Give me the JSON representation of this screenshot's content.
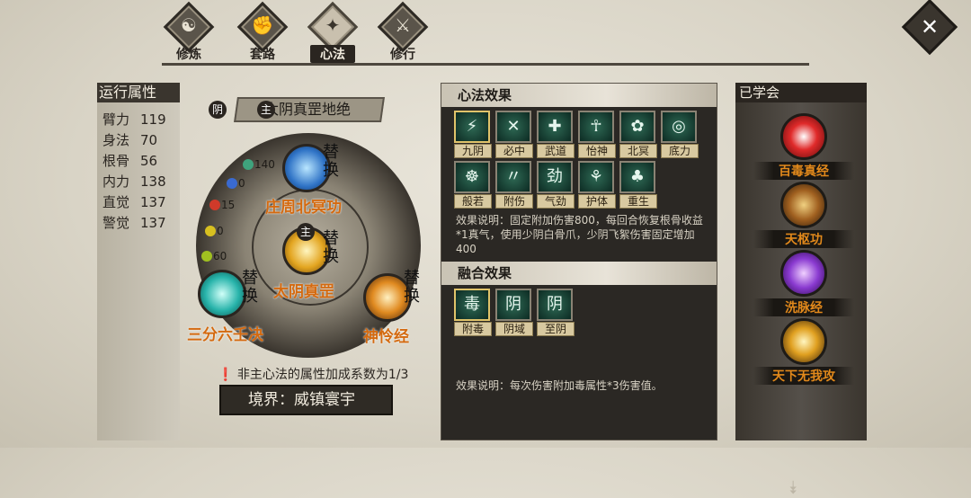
{
  "tabs": [
    {
      "label": "修炼",
      "glyph": "☯"
    },
    {
      "label": "套路",
      "glyph": "✊"
    },
    {
      "label": "心法",
      "glyph": "✦",
      "active": true
    },
    {
      "label": "修行",
      "glyph": "⚔"
    }
  ],
  "attributes": {
    "title": "运行属性",
    "rows": [
      {
        "name": "臂力",
        "value": "119"
      },
      {
        "name": "身法",
        "value": "70"
      },
      {
        "name": "根骨",
        "value": "56"
      },
      {
        "name": "内力",
        "value": "138"
      },
      {
        "name": "直觉",
        "value": "137"
      },
      {
        "name": "警觉",
        "value": "137"
      }
    ]
  },
  "wheel": {
    "yin_badge": "阴",
    "main_badge": "主",
    "main_name": "太阴真罡地绝",
    "stats": [
      "140",
      "0",
      "15",
      "0",
      "60"
    ],
    "slots": [
      {
        "name": "庄周北冥功",
        "swap": "替换"
      },
      {
        "name": "太阴真罡",
        "swap": "替换",
        "badge": "主"
      },
      {
        "name": "三分六壬决",
        "swap": "替换"
      },
      {
        "name": "神怜经",
        "swap": "替换"
      }
    ],
    "note": "非主心法的属性加成系数为1/3",
    "realm": "境界：威镇寰宇"
  },
  "effects": {
    "title": "心法效果",
    "items": [
      {
        "label": "九阴",
        "icon": "⚡"
      },
      {
        "label": "必中",
        "icon": "✕"
      },
      {
        "label": "武道",
        "icon": "✚"
      },
      {
        "label": "怡神",
        "icon": "☥"
      },
      {
        "label": "北冥",
        "icon": "✿"
      },
      {
        "label": "底力",
        "icon": "◎"
      },
      {
        "label": "般若",
        "icon": "☸"
      },
      {
        "label": "附伤",
        "icon": "〃"
      },
      {
        "label": "气劲",
        "icon": "劲"
      },
      {
        "label": "护体",
        "icon": "⚘"
      },
      {
        "label": "重生",
        "icon": "♣"
      }
    ],
    "description": "效果说明：固定附加伤害800，每回合恢复根骨收益*1真气，使用少阴白骨爪，少阴飞絮伤害固定增加400",
    "fusion_title": "融合效果",
    "fusion_items": [
      {
        "label": "附毒",
        "icon": "毒"
      },
      {
        "label": "阴域",
        "icon": "阴"
      },
      {
        "label": "至阴",
        "icon": "阴"
      }
    ],
    "fusion_description": "效果说明：每次伤害附加毒属性*3伤害值。"
  },
  "learned": {
    "title": "已学会",
    "items": [
      {
        "name": "百毒真经"
      },
      {
        "name": "天枢功"
      },
      {
        "name": "洗脉经"
      },
      {
        "name": "天下无我攻"
      }
    ]
  },
  "close_icon": "✕"
}
